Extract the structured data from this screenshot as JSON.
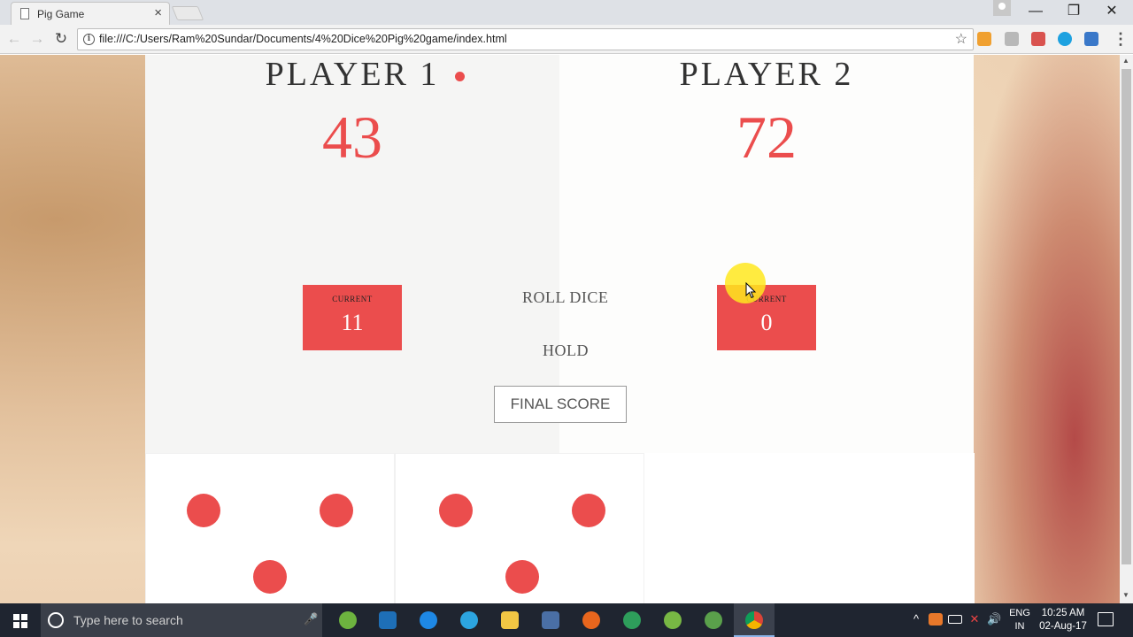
{
  "browser": {
    "tab_title": "Pig Game",
    "tab_close": "×",
    "url": "file:///C:/Users/Ram%20Sundar/Documents/4%20Dice%20Pig%20game/index.html",
    "window_controls": {
      "minimize": "—",
      "maximize": "❐",
      "close": "✕"
    },
    "nav": {
      "back": "←",
      "forward": "→",
      "reload": "↻"
    },
    "bookmark_icon": "star-icon",
    "menu": "⋮"
  },
  "game": {
    "active_player": 1,
    "players": [
      {
        "name": "PLAYER 1",
        "score": "43",
        "current_label": "CURRENT",
        "current_score": "11"
      },
      {
        "name": "PLAYER 2",
        "score": "72",
        "current_label": "CURRENT",
        "current_score": "0"
      }
    ],
    "buttons": {
      "roll": "ROLL DICE",
      "hold": "HOLD",
      "final_score": "FINAL SCORE"
    },
    "dice": [
      3,
      3
    ],
    "accent_color": "#eb4d4d"
  },
  "taskbar": {
    "search_placeholder": "Type here to search",
    "language": {
      "line1": "ENG",
      "line2": "IN"
    },
    "time": "10:25 AM",
    "date": "02-Aug-17"
  }
}
